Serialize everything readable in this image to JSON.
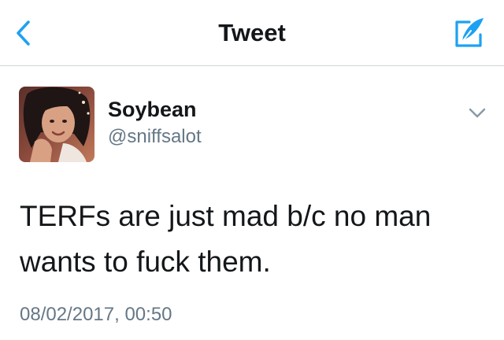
{
  "nav": {
    "title": "Tweet",
    "back_icon": "chevron-left-icon",
    "compose_icon": "compose-quill-icon",
    "accent_color": "#1da1f2"
  },
  "tweet": {
    "display_name": "Soybean",
    "username": "@sniffsalot",
    "text": "TERFs are just mad b/c no man wants to fuck them.",
    "timestamp": "08/02/2017, 00:50",
    "caret_icon": "chevron-down-icon"
  },
  "colors": {
    "primary_text": "#14171a",
    "secondary_text": "#657786",
    "divider": "#cfd4d8"
  }
}
